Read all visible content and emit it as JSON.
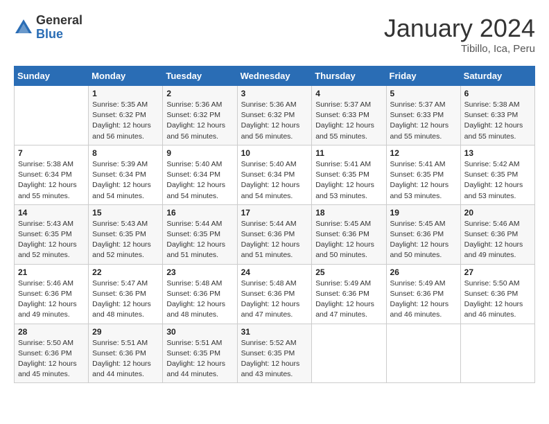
{
  "logo": {
    "general": "General",
    "blue": "Blue"
  },
  "title": "January 2024",
  "subtitle": "Tibillo, Ica, Peru",
  "days_of_week": [
    "Sunday",
    "Monday",
    "Tuesday",
    "Wednesday",
    "Thursday",
    "Friday",
    "Saturday"
  ],
  "weeks": [
    [
      {
        "day": "",
        "info": ""
      },
      {
        "day": "1",
        "info": "Sunrise: 5:35 AM\nSunset: 6:32 PM\nDaylight: 12 hours\nand 56 minutes."
      },
      {
        "day": "2",
        "info": "Sunrise: 5:36 AM\nSunset: 6:32 PM\nDaylight: 12 hours\nand 56 minutes."
      },
      {
        "day": "3",
        "info": "Sunrise: 5:36 AM\nSunset: 6:32 PM\nDaylight: 12 hours\nand 56 minutes."
      },
      {
        "day": "4",
        "info": "Sunrise: 5:37 AM\nSunset: 6:33 PM\nDaylight: 12 hours\nand 55 minutes."
      },
      {
        "day": "5",
        "info": "Sunrise: 5:37 AM\nSunset: 6:33 PM\nDaylight: 12 hours\nand 55 minutes."
      },
      {
        "day": "6",
        "info": "Sunrise: 5:38 AM\nSunset: 6:33 PM\nDaylight: 12 hours\nand 55 minutes."
      }
    ],
    [
      {
        "day": "7",
        "info": "Sunrise: 5:38 AM\nSunset: 6:34 PM\nDaylight: 12 hours\nand 55 minutes."
      },
      {
        "day": "8",
        "info": "Sunrise: 5:39 AM\nSunset: 6:34 PM\nDaylight: 12 hours\nand 54 minutes."
      },
      {
        "day": "9",
        "info": "Sunrise: 5:40 AM\nSunset: 6:34 PM\nDaylight: 12 hours\nand 54 minutes."
      },
      {
        "day": "10",
        "info": "Sunrise: 5:40 AM\nSunset: 6:34 PM\nDaylight: 12 hours\nand 54 minutes."
      },
      {
        "day": "11",
        "info": "Sunrise: 5:41 AM\nSunset: 6:35 PM\nDaylight: 12 hours\nand 53 minutes."
      },
      {
        "day": "12",
        "info": "Sunrise: 5:41 AM\nSunset: 6:35 PM\nDaylight: 12 hours\nand 53 minutes."
      },
      {
        "day": "13",
        "info": "Sunrise: 5:42 AM\nSunset: 6:35 PM\nDaylight: 12 hours\nand 53 minutes."
      }
    ],
    [
      {
        "day": "14",
        "info": "Sunrise: 5:43 AM\nSunset: 6:35 PM\nDaylight: 12 hours\nand 52 minutes."
      },
      {
        "day": "15",
        "info": "Sunrise: 5:43 AM\nSunset: 6:35 PM\nDaylight: 12 hours\nand 52 minutes."
      },
      {
        "day": "16",
        "info": "Sunrise: 5:44 AM\nSunset: 6:35 PM\nDaylight: 12 hours\nand 51 minutes."
      },
      {
        "day": "17",
        "info": "Sunrise: 5:44 AM\nSunset: 6:36 PM\nDaylight: 12 hours\nand 51 minutes."
      },
      {
        "day": "18",
        "info": "Sunrise: 5:45 AM\nSunset: 6:36 PM\nDaylight: 12 hours\nand 50 minutes."
      },
      {
        "day": "19",
        "info": "Sunrise: 5:45 AM\nSunset: 6:36 PM\nDaylight: 12 hours\nand 50 minutes."
      },
      {
        "day": "20",
        "info": "Sunrise: 5:46 AM\nSunset: 6:36 PM\nDaylight: 12 hours\nand 49 minutes."
      }
    ],
    [
      {
        "day": "21",
        "info": "Sunrise: 5:46 AM\nSunset: 6:36 PM\nDaylight: 12 hours\nand 49 minutes."
      },
      {
        "day": "22",
        "info": "Sunrise: 5:47 AM\nSunset: 6:36 PM\nDaylight: 12 hours\nand 48 minutes."
      },
      {
        "day": "23",
        "info": "Sunrise: 5:48 AM\nSunset: 6:36 PM\nDaylight: 12 hours\nand 48 minutes."
      },
      {
        "day": "24",
        "info": "Sunrise: 5:48 AM\nSunset: 6:36 PM\nDaylight: 12 hours\nand 47 minutes."
      },
      {
        "day": "25",
        "info": "Sunrise: 5:49 AM\nSunset: 6:36 PM\nDaylight: 12 hours\nand 47 minutes."
      },
      {
        "day": "26",
        "info": "Sunrise: 5:49 AM\nSunset: 6:36 PM\nDaylight: 12 hours\nand 46 minutes."
      },
      {
        "day": "27",
        "info": "Sunrise: 5:50 AM\nSunset: 6:36 PM\nDaylight: 12 hours\nand 46 minutes."
      }
    ],
    [
      {
        "day": "28",
        "info": "Sunrise: 5:50 AM\nSunset: 6:36 PM\nDaylight: 12 hours\nand 45 minutes."
      },
      {
        "day": "29",
        "info": "Sunrise: 5:51 AM\nSunset: 6:36 PM\nDaylight: 12 hours\nand 44 minutes."
      },
      {
        "day": "30",
        "info": "Sunrise: 5:51 AM\nSunset: 6:35 PM\nDaylight: 12 hours\nand 44 minutes."
      },
      {
        "day": "31",
        "info": "Sunrise: 5:52 AM\nSunset: 6:35 PM\nDaylight: 12 hours\nand 43 minutes."
      },
      {
        "day": "",
        "info": ""
      },
      {
        "day": "",
        "info": ""
      },
      {
        "day": "",
        "info": ""
      }
    ]
  ]
}
